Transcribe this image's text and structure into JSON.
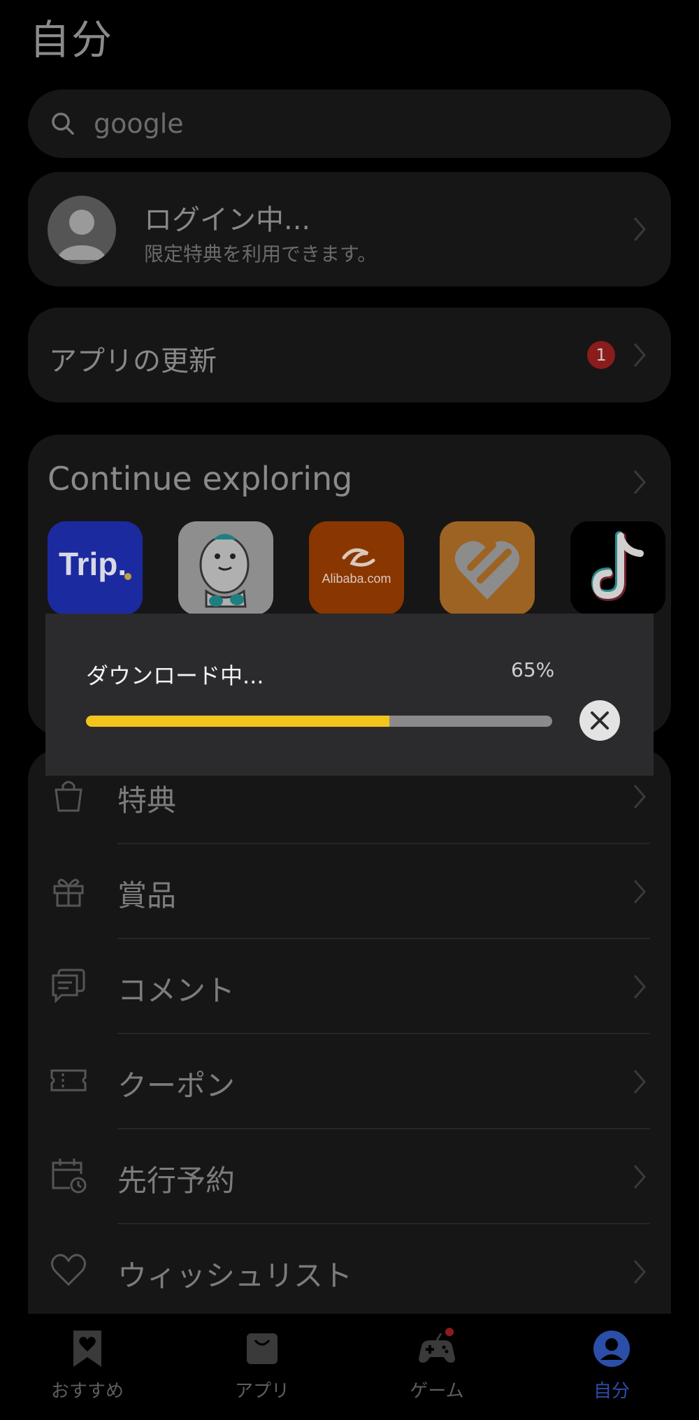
{
  "header": {
    "title": "自分"
  },
  "search": {
    "text": "google"
  },
  "login": {
    "title": "ログイン中...",
    "subtitle": "限定特典を利用できます。"
  },
  "updates": {
    "label": "アプリの更新",
    "badge": "1"
  },
  "explore": {
    "title": "Continue exploring",
    "apps": [
      {
        "name": "Trip.com",
        "icon": "trip-icon",
        "text": "Trip."
      },
      {
        "name": "Bigo Live",
        "icon": "bigo-icon"
      },
      {
        "name": "Alibaba.com",
        "icon": "alibaba-icon",
        "text": "Alibaba.com"
      },
      {
        "name": "Heart app",
        "icon": "heart-app-icon"
      },
      {
        "name": "TikTok",
        "icon": "tiktok-icon"
      }
    ]
  },
  "download": {
    "title": "ダウンロード中...",
    "percent_label": "65%",
    "progress": 0.65
  },
  "menu": {
    "items": [
      {
        "label": "特典",
        "icon": "shopping-bag-icon"
      },
      {
        "label": "賞品",
        "icon": "gift-icon"
      },
      {
        "label": "コメント",
        "icon": "comment-icon"
      },
      {
        "label": "クーポン",
        "icon": "coupon-icon"
      },
      {
        "label": "先行予約",
        "icon": "calendar-clock-icon"
      },
      {
        "label": "ウィッシュリスト",
        "icon": "heart-icon"
      }
    ]
  },
  "tabs": [
    {
      "label": "おすすめ",
      "icon": "bookmark-heart-icon",
      "active": false
    },
    {
      "label": "アプリ",
      "icon": "app-bag-icon",
      "active": false
    },
    {
      "label": "ゲーム",
      "icon": "gamepad-icon",
      "active": false
    },
    {
      "label": "自分",
      "icon": "profile-icon",
      "active": true
    }
  ],
  "colors": {
    "accent": "#2b4ea8",
    "progress": "#f2c51d",
    "badge": "#8b1c1c"
  }
}
